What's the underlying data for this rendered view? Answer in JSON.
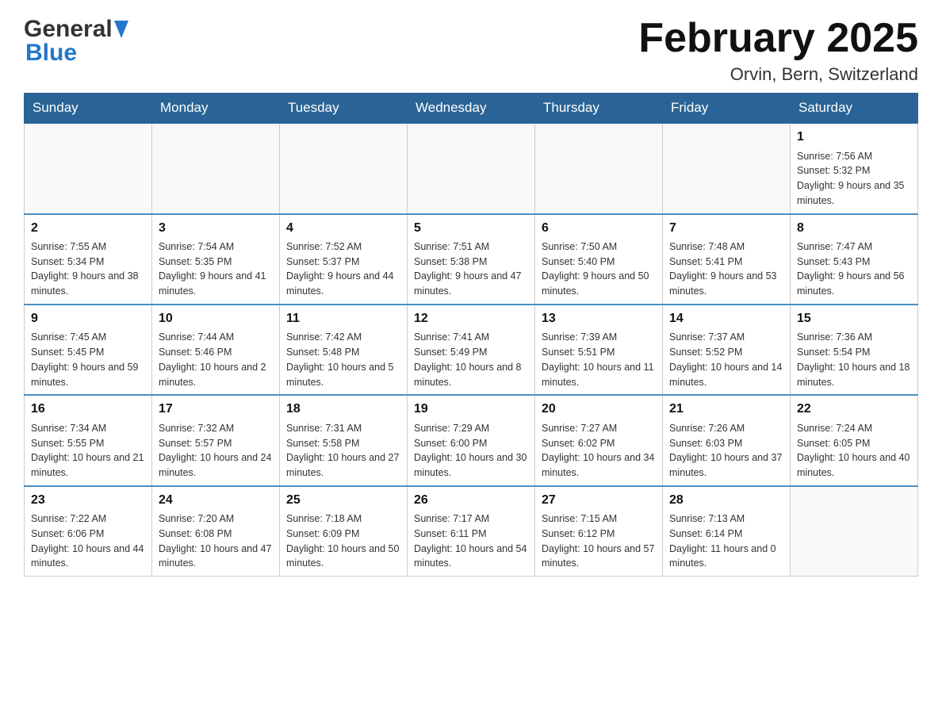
{
  "header": {
    "logo_general": "General",
    "logo_blue": "Blue",
    "title": "February 2025",
    "subtitle": "Orvin, Bern, Switzerland"
  },
  "days_of_week": [
    "Sunday",
    "Monday",
    "Tuesday",
    "Wednesday",
    "Thursday",
    "Friday",
    "Saturday"
  ],
  "weeks": [
    [
      {
        "day": "",
        "info": ""
      },
      {
        "day": "",
        "info": ""
      },
      {
        "day": "",
        "info": ""
      },
      {
        "day": "",
        "info": ""
      },
      {
        "day": "",
        "info": ""
      },
      {
        "day": "",
        "info": ""
      },
      {
        "day": "1",
        "info": "Sunrise: 7:56 AM\nSunset: 5:32 PM\nDaylight: 9 hours and 35 minutes."
      }
    ],
    [
      {
        "day": "2",
        "info": "Sunrise: 7:55 AM\nSunset: 5:34 PM\nDaylight: 9 hours and 38 minutes."
      },
      {
        "day": "3",
        "info": "Sunrise: 7:54 AM\nSunset: 5:35 PM\nDaylight: 9 hours and 41 minutes."
      },
      {
        "day": "4",
        "info": "Sunrise: 7:52 AM\nSunset: 5:37 PM\nDaylight: 9 hours and 44 minutes."
      },
      {
        "day": "5",
        "info": "Sunrise: 7:51 AM\nSunset: 5:38 PM\nDaylight: 9 hours and 47 minutes."
      },
      {
        "day": "6",
        "info": "Sunrise: 7:50 AM\nSunset: 5:40 PM\nDaylight: 9 hours and 50 minutes."
      },
      {
        "day": "7",
        "info": "Sunrise: 7:48 AM\nSunset: 5:41 PM\nDaylight: 9 hours and 53 minutes."
      },
      {
        "day": "8",
        "info": "Sunrise: 7:47 AM\nSunset: 5:43 PM\nDaylight: 9 hours and 56 minutes."
      }
    ],
    [
      {
        "day": "9",
        "info": "Sunrise: 7:45 AM\nSunset: 5:45 PM\nDaylight: 9 hours and 59 minutes."
      },
      {
        "day": "10",
        "info": "Sunrise: 7:44 AM\nSunset: 5:46 PM\nDaylight: 10 hours and 2 minutes."
      },
      {
        "day": "11",
        "info": "Sunrise: 7:42 AM\nSunset: 5:48 PM\nDaylight: 10 hours and 5 minutes."
      },
      {
        "day": "12",
        "info": "Sunrise: 7:41 AM\nSunset: 5:49 PM\nDaylight: 10 hours and 8 minutes."
      },
      {
        "day": "13",
        "info": "Sunrise: 7:39 AM\nSunset: 5:51 PM\nDaylight: 10 hours and 11 minutes."
      },
      {
        "day": "14",
        "info": "Sunrise: 7:37 AM\nSunset: 5:52 PM\nDaylight: 10 hours and 14 minutes."
      },
      {
        "day": "15",
        "info": "Sunrise: 7:36 AM\nSunset: 5:54 PM\nDaylight: 10 hours and 18 minutes."
      }
    ],
    [
      {
        "day": "16",
        "info": "Sunrise: 7:34 AM\nSunset: 5:55 PM\nDaylight: 10 hours and 21 minutes."
      },
      {
        "day": "17",
        "info": "Sunrise: 7:32 AM\nSunset: 5:57 PM\nDaylight: 10 hours and 24 minutes."
      },
      {
        "day": "18",
        "info": "Sunrise: 7:31 AM\nSunset: 5:58 PM\nDaylight: 10 hours and 27 minutes."
      },
      {
        "day": "19",
        "info": "Sunrise: 7:29 AM\nSunset: 6:00 PM\nDaylight: 10 hours and 30 minutes."
      },
      {
        "day": "20",
        "info": "Sunrise: 7:27 AM\nSunset: 6:02 PM\nDaylight: 10 hours and 34 minutes."
      },
      {
        "day": "21",
        "info": "Sunrise: 7:26 AM\nSunset: 6:03 PM\nDaylight: 10 hours and 37 minutes."
      },
      {
        "day": "22",
        "info": "Sunrise: 7:24 AM\nSunset: 6:05 PM\nDaylight: 10 hours and 40 minutes."
      }
    ],
    [
      {
        "day": "23",
        "info": "Sunrise: 7:22 AM\nSunset: 6:06 PM\nDaylight: 10 hours and 44 minutes."
      },
      {
        "day": "24",
        "info": "Sunrise: 7:20 AM\nSunset: 6:08 PM\nDaylight: 10 hours and 47 minutes."
      },
      {
        "day": "25",
        "info": "Sunrise: 7:18 AM\nSunset: 6:09 PM\nDaylight: 10 hours and 50 minutes."
      },
      {
        "day": "26",
        "info": "Sunrise: 7:17 AM\nSunset: 6:11 PM\nDaylight: 10 hours and 54 minutes."
      },
      {
        "day": "27",
        "info": "Sunrise: 7:15 AM\nSunset: 6:12 PM\nDaylight: 10 hours and 57 minutes."
      },
      {
        "day": "28",
        "info": "Sunrise: 7:13 AM\nSunset: 6:14 PM\nDaylight: 11 hours and 0 minutes."
      },
      {
        "day": "",
        "info": ""
      }
    ]
  ]
}
